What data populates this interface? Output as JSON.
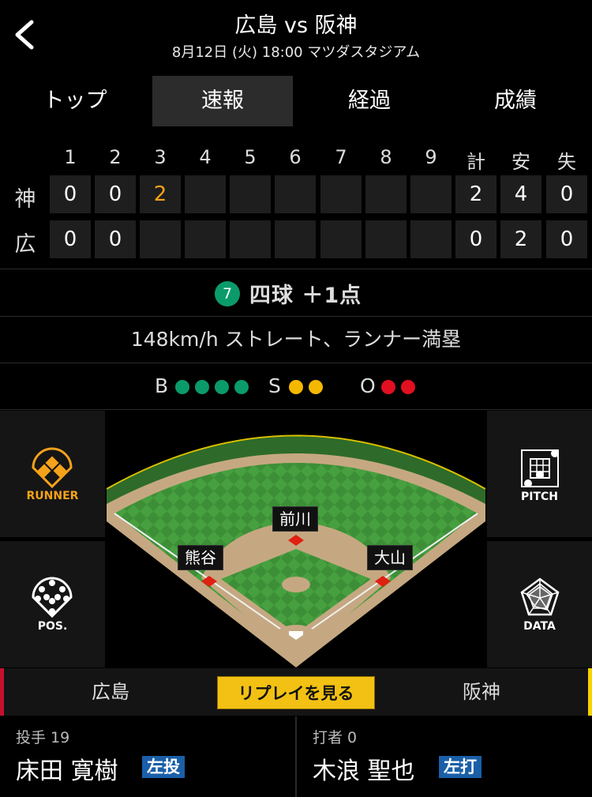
{
  "header": {
    "title": "広島 vs 阪神",
    "subtitle": "8月12日 (火) 18:00 マツダスタジアム"
  },
  "tabs": [
    {
      "label": "トップ",
      "active": false
    },
    {
      "label": "速報",
      "active": true
    },
    {
      "label": "経過",
      "active": false
    },
    {
      "label": "成績",
      "active": false
    }
  ],
  "scoreboard": {
    "headers": [
      "1",
      "2",
      "3",
      "4",
      "5",
      "6",
      "7",
      "8",
      "9",
      "計",
      "安",
      "失"
    ],
    "rows": [
      {
        "team": "神",
        "cells": [
          "0",
          "0",
          "2",
          "",
          "",
          "",
          "",
          "",
          "",
          "2",
          "4",
          "0"
        ]
      },
      {
        "team": "広",
        "cells": [
          "0",
          "0",
          "",
          "",
          "",
          "",
          "",
          "",
          "",
          "0",
          "2",
          "0"
        ]
      }
    ]
  },
  "play": {
    "badge": "7",
    "text": "四球 ＋1点",
    "description": "148km/h ストレート、ランナー満塁"
  },
  "count": {
    "b_label": "B",
    "balls": 4,
    "s_label": "S",
    "strikes": 2,
    "o_label": "O",
    "outs": 2,
    "ball_color": "#0b9b6a",
    "strike_color": "#f5b800",
    "out_color": "#e01020"
  },
  "side_buttons": {
    "runner": "RUNNER",
    "pitch": "PITCH",
    "pos": "POS.",
    "data": "DATA"
  },
  "field": {
    "runners": {
      "first": "大山",
      "second": "前川",
      "third": "熊谷"
    }
  },
  "team_bar": {
    "left": "広島",
    "replay": "リプレイを見る",
    "right": "阪神",
    "left_color": "#c8102e",
    "right_color": "#f5d400"
  },
  "players": {
    "pitcher": {
      "role": "投手 19",
      "name": "床田 寛樹",
      "hand": "左投"
    },
    "batter": {
      "role": "打者 0",
      "name": "木浪 聖也",
      "hand": "左打"
    }
  }
}
